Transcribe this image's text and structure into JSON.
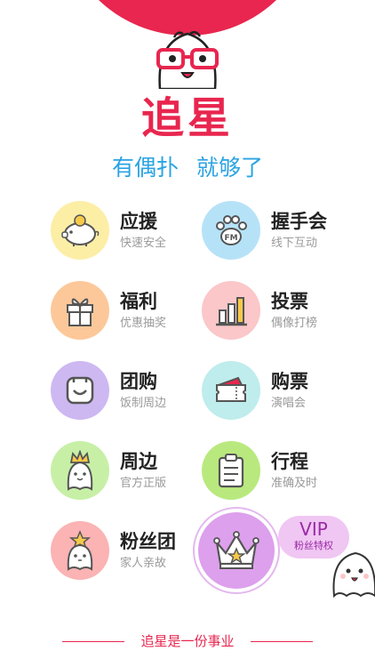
{
  "brand": {
    "logo_text": "追星",
    "slogan_part1": "有偶扑",
    "slogan_part2": "就够了",
    "primary_color": "#e8264f",
    "slogan_color": "#2aa3e3"
  },
  "menu": [
    {
      "title": "应援",
      "subtitle": "快速安全",
      "icon": "piggy-bank-icon",
      "bg": "#fdeea6"
    },
    {
      "title": "握手会",
      "subtitle": "线下互动",
      "icon": "paw-fm-icon",
      "bg": "#b6e2f8"
    },
    {
      "title": "福利",
      "subtitle": "优惠抽奖",
      "icon": "gift-icon",
      "bg": "#fcc89a"
    },
    {
      "title": "投票",
      "subtitle": "偶像打榜",
      "icon": "bar-chart-icon",
      "bg": "#fbc7c9"
    },
    {
      "title": "团购",
      "subtitle": "饭制周边",
      "icon": "smile-box-icon",
      "bg": "#cdb8f1"
    },
    {
      "title": "购票",
      "subtitle": "演唱会",
      "icon": "ticket-icon",
      "bg": "#bfecec"
    },
    {
      "title": "周边",
      "subtitle": "官方正版",
      "icon": "crown-ghost-icon",
      "bg": "#c7f0a6"
    },
    {
      "title": "行程",
      "subtitle": "准确及时",
      "icon": "clipboard-icon",
      "bg": "#b9e97e"
    },
    {
      "title": "粉丝团",
      "subtitle": "家人亲故",
      "icon": "star-ghost-icon",
      "bg": "#fbb3b3"
    }
  ],
  "vip": {
    "label": "VIP",
    "sublabel": "粉丝特权",
    "icon": "vip-crown-icon",
    "bubble_color": "#f0c6f3",
    "circle_color": "#dda0ec"
  },
  "footer": {
    "text": "追星是一份事业"
  }
}
